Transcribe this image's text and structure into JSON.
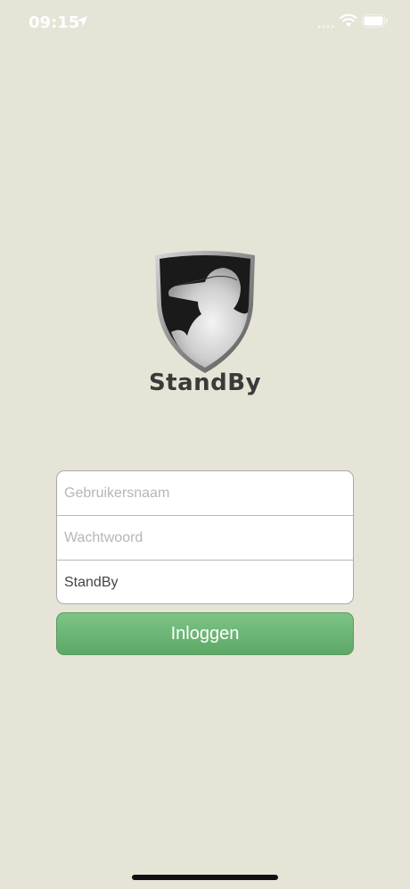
{
  "status_bar": {
    "time": "09:15"
  },
  "app": {
    "logo_text": "StandBy"
  },
  "form": {
    "username_placeholder": "Gebruikersnaam",
    "password_placeholder": "Wachtwoord",
    "environment_value": "StandBy"
  },
  "login_button": {
    "label": "Inloggen"
  },
  "colors": {
    "background": "#e6e4d7",
    "button": "#6ab673",
    "text_dark": "#3a3a3a"
  },
  "icons": [
    "location-arrow-icon",
    "signal-icon",
    "wifi-icon",
    "battery-icon",
    "shield-logo-icon"
  ]
}
